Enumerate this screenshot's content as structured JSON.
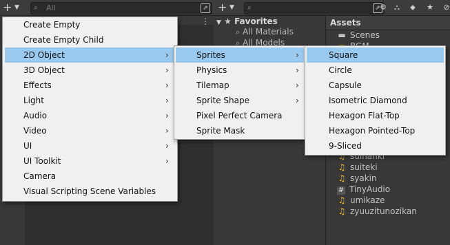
{
  "hierarchy": {
    "search_placeholder": "All"
  },
  "project": {
    "favorites_label": "Favorites",
    "favorites": [
      "All Materials",
      "All Models"
    ],
    "assets_title": "Assets",
    "assets": [
      {
        "name": "Scenes",
        "icon": "folder-icon"
      },
      {
        "name": "BGM",
        "icon": "folder-icon"
      },
      {
        "name": "suihanki",
        "icon": "audio-clip-icon"
      },
      {
        "name": "suiteki",
        "icon": "audio-clip-icon"
      },
      {
        "name": "syakin",
        "icon": "audio-clip-icon"
      },
      {
        "name": "TinyAudio",
        "icon": "csharp-script-icon"
      },
      {
        "name": "umikaze",
        "icon": "audio-clip-icon"
      },
      {
        "name": "zyuuzitunozikan",
        "icon": "audio-clip-icon"
      }
    ]
  },
  "menu_main": [
    {
      "label": "Create Empty",
      "submenu": false
    },
    {
      "label": "Create Empty Child",
      "submenu": false
    },
    {
      "label": "2D Object",
      "submenu": true,
      "selected": true
    },
    {
      "label": "3D Object",
      "submenu": true
    },
    {
      "label": "Effects",
      "submenu": true
    },
    {
      "label": "Light",
      "submenu": true
    },
    {
      "label": "Audio",
      "submenu": true
    },
    {
      "label": "Video",
      "submenu": true
    },
    {
      "label": "UI",
      "submenu": true
    },
    {
      "label": "UI Toolkit",
      "submenu": true
    },
    {
      "label": "Camera",
      "submenu": false
    },
    {
      "label": "Visual Scripting Scene Variables",
      "submenu": false
    }
  ],
  "menu_2d": [
    {
      "label": "Sprites",
      "submenu": true,
      "selected": true
    },
    {
      "label": "Physics",
      "submenu": true
    },
    {
      "label": "Tilemap",
      "submenu": true
    },
    {
      "label": "Sprite Shape",
      "submenu": true
    },
    {
      "label": "Pixel Perfect Camera",
      "submenu": false
    },
    {
      "label": "Sprite Mask",
      "submenu": false
    }
  ],
  "menu_sprites": [
    {
      "label": "Square",
      "selected": true
    },
    {
      "label": "Circle"
    },
    {
      "label": "Capsule"
    },
    {
      "label": "Isometric Diamond"
    },
    {
      "label": "Hexagon Flat-Top"
    },
    {
      "label": "Hexagon Pointed-Top"
    },
    {
      "label": "9-Sliced"
    }
  ],
  "colors": {
    "menu_bg": "#f0f0f0",
    "menu_selected": "#99c9ef",
    "panel_bg": "#383838",
    "audio_icon": "#f1c232"
  }
}
